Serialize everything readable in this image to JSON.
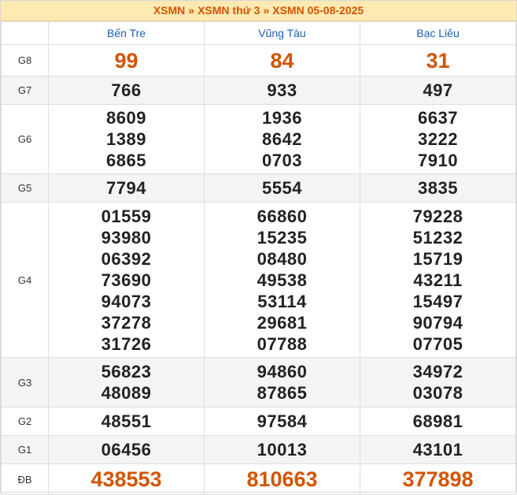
{
  "breadcrumb": {
    "items": [
      "XSMN",
      "XSMN thứ 3",
      "XSMN 05-08-2025"
    ],
    "separator": "»"
  },
  "provinces": [
    "Bến Tre",
    "Vũng Tàu",
    "Bạc Liêu"
  ],
  "prizes": {
    "g8": {
      "label": "G8",
      "values": [
        "99",
        "84",
        "31"
      ]
    },
    "g7": {
      "label": "G7",
      "values": [
        "766",
        "933",
        "497"
      ]
    },
    "g6": {
      "label": "G6",
      "values": [
        [
          "8609",
          "1389",
          "6865"
        ],
        [
          "1936",
          "8642",
          "0703"
        ],
        [
          "6637",
          "3222",
          "7910"
        ]
      ]
    },
    "g5": {
      "label": "G5",
      "values": [
        "7794",
        "5554",
        "3835"
      ]
    },
    "g4": {
      "label": "G4",
      "values": [
        [
          "01559",
          "93980",
          "06392",
          "73690",
          "94073",
          "37278",
          "31726"
        ],
        [
          "66860",
          "15235",
          "08480",
          "49538",
          "53114",
          "29681",
          "07788"
        ],
        [
          "79228",
          "51232",
          "15719",
          "43211",
          "15497",
          "90794",
          "07705"
        ]
      ]
    },
    "g3": {
      "label": "G3",
      "values": [
        [
          "56823",
          "48089"
        ],
        [
          "94860",
          "87865"
        ],
        [
          "34972",
          "03078"
        ]
      ]
    },
    "g2": {
      "label": "G2",
      "values": [
        "48551",
        "97584",
        "68981"
      ]
    },
    "g1": {
      "label": "G1",
      "values": [
        "06456",
        "10013",
        "43101"
      ]
    },
    "db": {
      "label": "ĐB",
      "values": [
        "438553",
        "810663",
        "377898"
      ]
    }
  },
  "colors": {
    "accent": "#d35400",
    "header_link": "#1a5fb4",
    "breadcrumb_bg": "#fde9b2"
  }
}
